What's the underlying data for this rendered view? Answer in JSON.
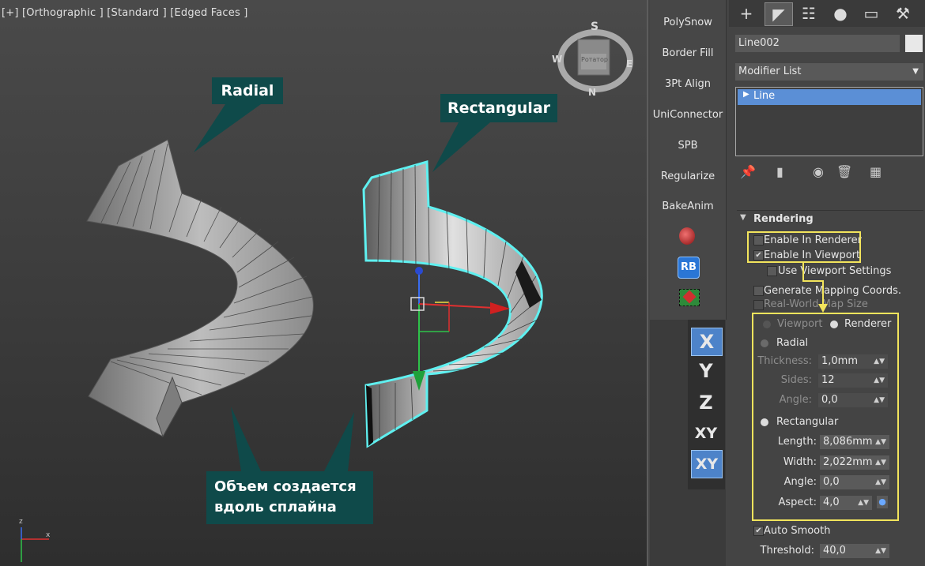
{
  "viewport": {
    "label": "[+] [Orthographic ] [Standard ] [Edged Faces ]",
    "callouts": {
      "radial": "Radial",
      "rectangular": "Rectangular",
      "note_line1": "Объем создается",
      "note_line2": "вдоль сплайна"
    },
    "viewcube": {
      "n": "N",
      "s": "S",
      "e": "E",
      "w": "W",
      "center": "Ротатор"
    },
    "axis_tripod": {
      "x": "x",
      "z": "z"
    }
  },
  "strip": {
    "buttons": [
      "PolySnow",
      "Border Fill",
      "3Pt Align",
      "UniConnector",
      "SPB",
      "Regularize",
      "BakeAnim"
    ],
    "rb_label": "RB",
    "axes": [
      "X",
      "Y",
      "Z",
      "XY",
      "XY"
    ]
  },
  "panel": {
    "object_name": "Line002",
    "modifier_list": "Modifier List",
    "stack_item": "Line",
    "rendering": {
      "title": "Rendering",
      "enable_renderer": "Enable In Renderer",
      "enable_viewport": "Enable In Viewport",
      "use_viewport_settings": "Use Viewport Settings",
      "generate_mapping": "Generate Mapping Coords.",
      "real_world": "Real-World Map Size",
      "viewport": "Viewport",
      "renderer": "Renderer",
      "radial": "Radial",
      "thickness_label": "Thickness:",
      "thickness_value": "1,0mm",
      "sides_label": "Sides:",
      "sides_value": "12",
      "angle_label": "Angle:",
      "angle_value_radial": "0,0",
      "rectangular": "Rectangular",
      "length_label": "Length:",
      "length_value": "8,086mm",
      "width_label": "Width:",
      "width_value": "2,022mm",
      "angle_value_rect": "0,0",
      "aspect_label": "Aspect:",
      "aspect_value": "4,0",
      "auto_smooth": "Auto Smooth",
      "threshold_label": "Threshold:",
      "threshold_value": "40,0"
    }
  },
  "colors": {
    "callout_bg": "#0f4a4a",
    "highlight": "#f2e45c",
    "selection_outline": "#5ff0f0",
    "stack_selected": "#5b8fd6"
  }
}
